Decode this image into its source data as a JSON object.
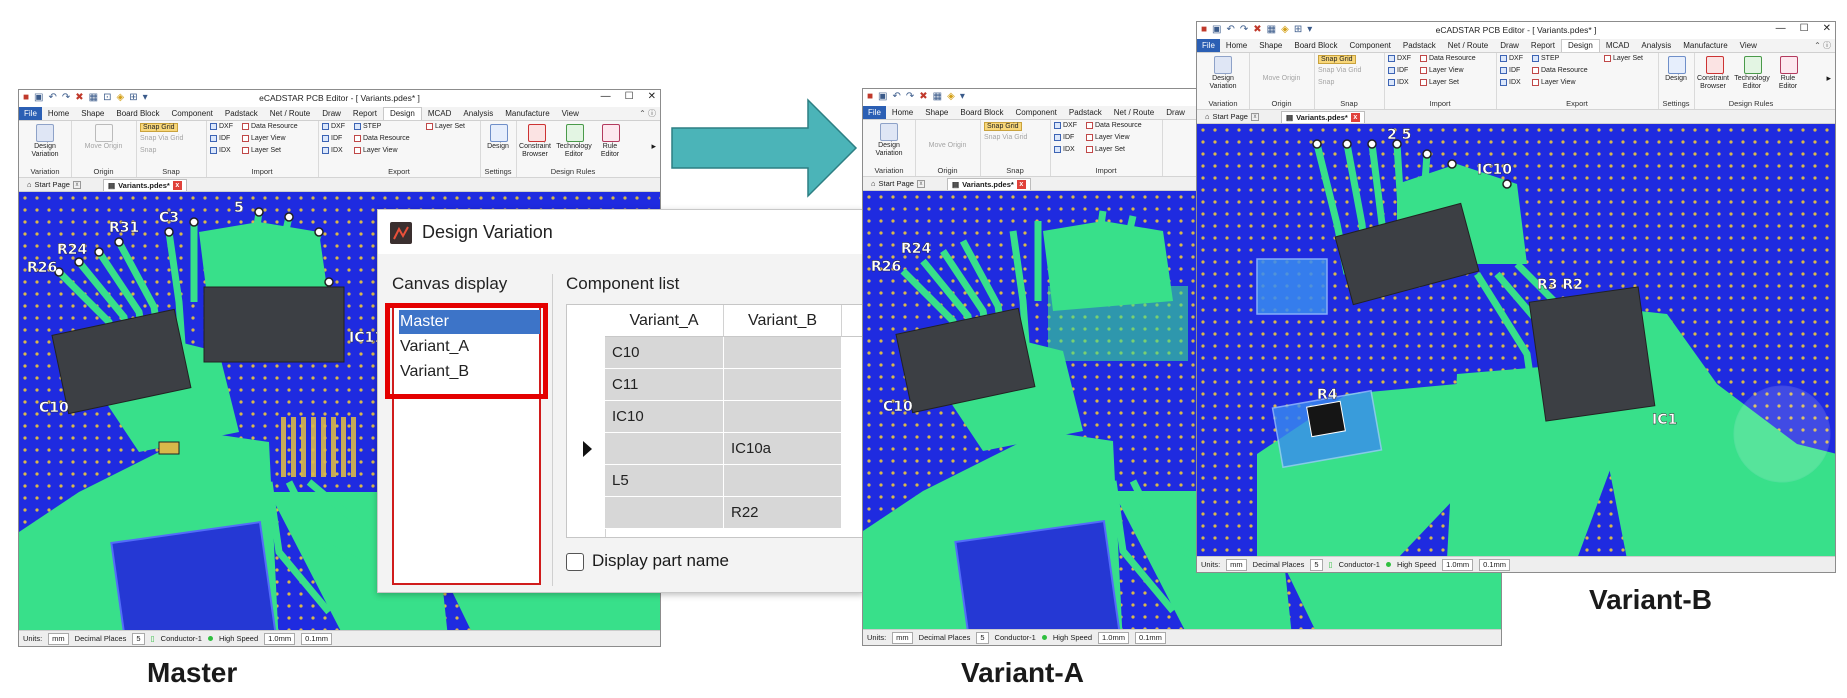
{
  "app": {
    "window_title": "eCADSTAR PCB Editor - [ Variants.pdes* ]",
    "menu": [
      "File",
      "Home",
      "Shape",
      "Board Block",
      "Component",
      "Padstack",
      "Net / Route",
      "Draw",
      "Report",
      "Design",
      "MCAD",
      "Analysis",
      "Manufacture",
      "View"
    ],
    "active_menu": "Design",
    "ribbon": {
      "variation": {
        "button": "Design Variation",
        "group": "Variation"
      },
      "origin": {
        "button": "Move Origin",
        "group": "Origin"
      },
      "snap": {
        "snap_grid": "Snap Grid",
        "snap_via_grid": "Snap Via Grid",
        "snap": "Snap",
        "group": "Snap"
      },
      "import": {
        "dxf": "DXF",
        "idf": "IDF",
        "idx": "IDX",
        "data_resource": "Data Resource",
        "layer_view": "Layer View",
        "layer_set": "Layer Set",
        "group": "Import"
      },
      "export": {
        "dxf": "DXF",
        "idf": "IDF",
        "idx": "IDX",
        "step": "STEP",
        "data_resource": "Data Resource",
        "layer_view": "Layer View",
        "layer_set": "Layer Set",
        "group": "Export"
      },
      "settings": {
        "design": "Design",
        "group": "Settings"
      },
      "design_rules": {
        "constraint_browser": "Constraint Browser",
        "technology_editor": "Technology Editor",
        "rule_editor": "Rule Editor",
        "group": "Design Rules"
      }
    },
    "tabs": {
      "start_page": "Start Page",
      "variants": "Variants.pdes*"
    },
    "status": {
      "units_label": "Units:",
      "units_value": "mm",
      "decimal_label": "Decimal Places",
      "decimal_value": "5",
      "conductor": "Conductor-1",
      "high_speed": "High Speed",
      "width1": "1.0mm",
      "width2": "0.1mm"
    }
  },
  "dialog": {
    "title": "Design Variation",
    "canvas_display_label": "Canvas display",
    "canvas_items": [
      "Master",
      "Variant_A",
      "Variant_B"
    ],
    "selected_item": "Master",
    "component_list_label": "Component list",
    "columns": [
      "Variant_A",
      "Variant_B"
    ],
    "rows": [
      {
        "a": "C10",
        "b": ""
      },
      {
        "a": "C11",
        "b": ""
      },
      {
        "a": "IC10",
        "b": ""
      },
      {
        "a": "",
        "b": "IC10a"
      },
      {
        "a": "L5",
        "b": ""
      },
      {
        "a": "",
        "b": "R22"
      }
    ],
    "display_part_name": "Display part name"
  },
  "captions": {
    "master": "Master",
    "variant_a": "Variant-A",
    "variant_b": "Variant-B"
  },
  "colors": {
    "board_blue": "#1f2be0",
    "copper_green": "#38e08a",
    "menu_blue": "#2b5fb4",
    "highlight_red": "#e40000",
    "arrow_teal": "#4bb4b8"
  }
}
